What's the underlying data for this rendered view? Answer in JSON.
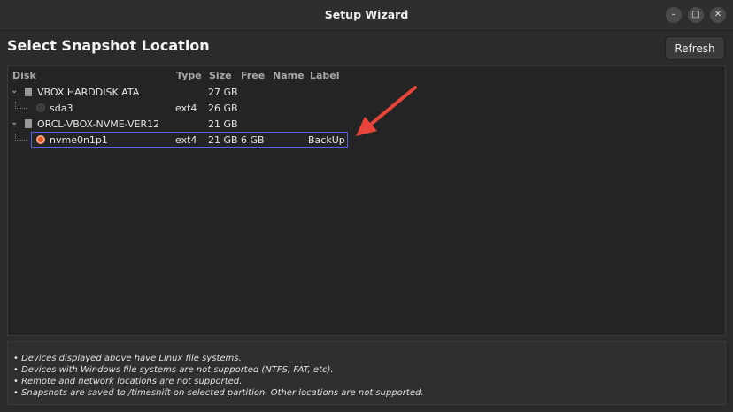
{
  "window": {
    "title": "Setup Wizard"
  },
  "page": {
    "title": "Select Snapshot Location",
    "refresh_label": "Refresh"
  },
  "table": {
    "headers": {
      "disk": "Disk",
      "type": "Type",
      "size": "Size",
      "free": "Free",
      "name": "Name",
      "label": "Label"
    },
    "disks": [
      {
        "name": "VBOX HARDDISK ATA",
        "size": "27 GB",
        "partitions": [
          {
            "name": "sda3",
            "type": "ext4",
            "size": "26 GB",
            "free": "",
            "label": "",
            "selected": false
          }
        ]
      },
      {
        "name": "ORCL-VBOX-NVME-VER12",
        "size": "21 GB",
        "partitions": [
          {
            "name": "nvme0n1p1",
            "type": "ext4",
            "size": "21 GB",
            "free": "6 GB",
            "label": "BackUp",
            "selected": true
          }
        ]
      }
    ]
  },
  "notes": [
    "• Devices displayed above have Linux file systems.",
    "• Devices with Windows file systems are not supported (NTFS, FAT, etc).",
    "• Remote and network locations are not supported.",
    "• Snapshots are saved to /timeshift on selected partition. Other locations are not supported."
  ],
  "colors": {
    "accent_radio": "#e95420",
    "selection_border": "#5a62e0",
    "annotation_arrow": "#e8443a"
  }
}
